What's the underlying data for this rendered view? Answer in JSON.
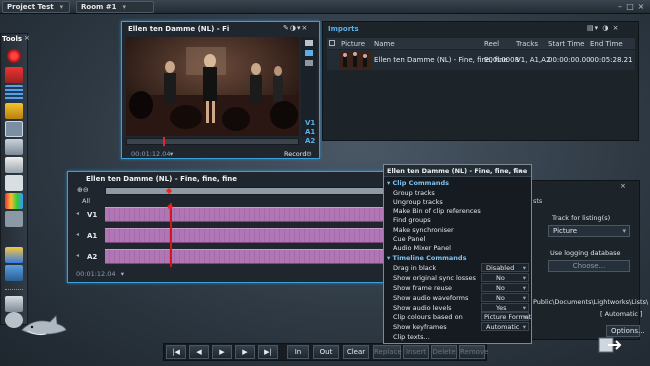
{
  "topbar": {
    "project": "Project Test",
    "room": "Room #1"
  },
  "tools": {
    "title": "Tools"
  },
  "viewer": {
    "title": "Ellen ten Damme (NL) - Fi",
    "timecode": "00:01:12.04",
    "record_label": "Record",
    "tracks": [
      "V1",
      "A1",
      "A2"
    ]
  },
  "imports": {
    "title": "Imports",
    "columns": [
      "Picture",
      "Name",
      "Reel",
      "Tracks",
      "Start Time",
      "End Time"
    ],
    "rows": [
      {
        "name": "Ellen ten Damme (NL) - Fine, fine, fine",
        "reel": "E00L0008",
        "tracks": "V1, A1,A2",
        "start": "00:00:00.00",
        "end": "00:05:28.21"
      }
    ]
  },
  "timeline": {
    "title": "Ellen ten Damme (NL) - Fine, fine, fine",
    "all_label": "All",
    "tracks": [
      "V1",
      "A1",
      "A2"
    ],
    "timecode": "00:01:12.04"
  },
  "menu": {
    "title": "Ellen ten Damme (NL) - Fine, fine, fine",
    "clip_header": "Clip Commands",
    "clip_items": [
      "Group tracks",
      "Ungroup tracks",
      "Make Bin of clip references",
      "Find groups",
      "Make synchroniser",
      "Cue Panel",
      "Audio Mixer Panel"
    ],
    "timeline_header": "Timeline Commands",
    "settings": [
      {
        "label": "Drag in black",
        "value": "Disabled"
      },
      {
        "label": "Show original sync losses",
        "value": "No"
      },
      {
        "label": "Show frame reuse",
        "value": "No"
      },
      {
        "label": "Show audio waveforms",
        "value": "No"
      },
      {
        "label": "Show audio levels",
        "value": "Yes"
      },
      {
        "label": "Clip colours based on",
        "value": "Picture Format"
      },
      {
        "label": "Show keyframes",
        "value": "Automatic"
      }
    ],
    "clip_texts": "Clip texts..."
  },
  "logging": {
    "tab_partial": "sts",
    "track_label": "Track for listing(s)",
    "track_value": "Picture",
    "use_db_label": "Use logging database",
    "choose_label": "Choose...",
    "path_text": "Public\\Documents\\Lightworks\\Lists\\",
    "automatic_text": "[ Automatic ]",
    "options_label": "Options..."
  },
  "transport": {
    "buttons": [
      "In",
      "Out",
      "Clear",
      "Replace",
      "Insert",
      "Delete",
      "Remove"
    ]
  }
}
